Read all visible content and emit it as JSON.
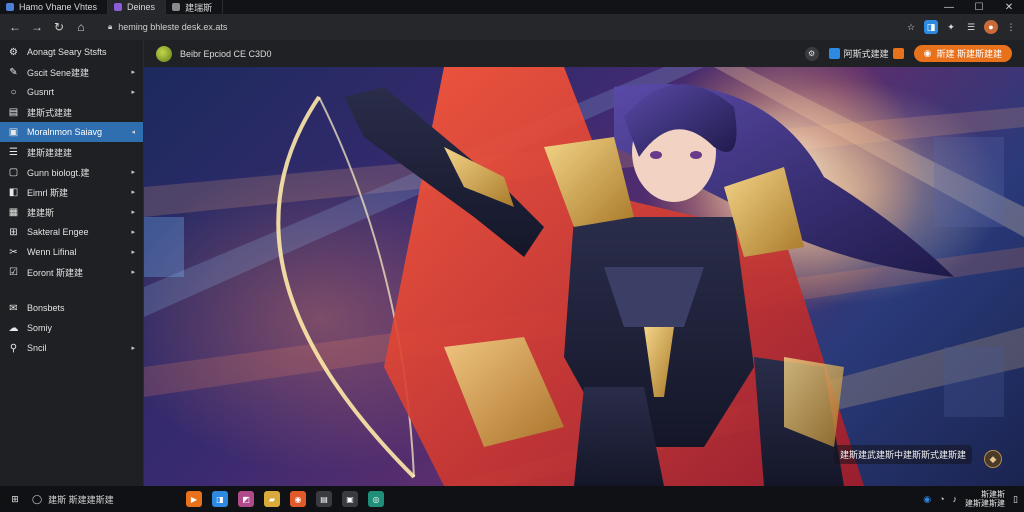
{
  "tabs": [
    {
      "label": "Hamo Vhane Vhtes",
      "color": "#4d7fd6"
    },
    {
      "label": "Deines",
      "color": "#8d5cd8"
    },
    {
      "label": "建瑞斯",
      "color": "#8a8a8a"
    }
  ],
  "window_controls": {
    "minimize": "—",
    "maximize": "☐",
    "close": "✕"
  },
  "address_bar": {
    "url": "heming bhleste desk.ex.ats"
  },
  "sidebar": {
    "items": [
      {
        "label": "Aonagt Seary Stsfts",
        "icon": "gear-icon",
        "glyph": "⚙",
        "arrow": ""
      },
      {
        "label": "Gscit Sene建建",
        "icon": "brush-icon",
        "glyph": "✎",
        "arrow": "▸"
      },
      {
        "label": "Gusnrt",
        "icon": "circle-icon",
        "glyph": "○",
        "arrow": "▸"
      },
      {
        "label": "建斯式建建",
        "icon": "book-icon",
        "glyph": "▤",
        "arrow": ""
      },
      {
        "label": "Moralnmon Saiavg",
        "icon": "window-icon",
        "glyph": "▣",
        "arrow": "◂",
        "active": true
      },
      {
        "label": "建斯建建建",
        "icon": "list-icon",
        "glyph": "☰",
        "arrow": ""
      },
      {
        "label": "Gunn biologt.建",
        "icon": "square-icon",
        "glyph": "▢",
        "arrow": "▸"
      },
      {
        "label": "Eimrl 斯建",
        "icon": "layers-icon",
        "glyph": "◧",
        "arrow": "▸"
      },
      {
        "label": "建建斯",
        "icon": "folder-icon",
        "glyph": "▦",
        "arrow": "▸"
      },
      {
        "label": "Sakteral Engee",
        "icon": "grid-icon",
        "glyph": "⊞",
        "arrow": "▸"
      },
      {
        "label": "Wenn Lifinal",
        "icon": "tool-icon",
        "glyph": "✂",
        "arrow": "▸"
      },
      {
        "label": "Eoront 斯建建",
        "icon": "check-icon",
        "glyph": "☑",
        "arrow": "▸"
      }
    ],
    "bottom_items": [
      {
        "label": "Bonsbets",
        "icon": "mail-icon",
        "glyph": "✉",
        "arrow": ""
      },
      {
        "label": "Somiy",
        "icon": "cloud-icon",
        "glyph": "☁",
        "arrow": ""
      },
      {
        "label": "Sncil",
        "icon": "link-icon",
        "glyph": "⚲",
        "arrow": "▸"
      }
    ]
  },
  "content_header": {
    "title": "Beibr Epciod CE C3D0",
    "chip_label": "阿斯式建建",
    "cta_label": "斯建 斯建斯建建"
  },
  "artwork": {
    "caption": "建斯建武建斯中建斯斯式建斯建",
    "badge_glyph": "◆"
  },
  "taskbar": {
    "search_text": "建斯 斯建建斯建",
    "apps": [
      {
        "name": "files-app-icon",
        "color": "#e8711c",
        "glyph": "▶"
      },
      {
        "name": "store-app-icon",
        "color": "#2d8ae0",
        "glyph": "◨"
      },
      {
        "name": "photos-app-icon",
        "color": "#b04a8a",
        "glyph": "◩"
      },
      {
        "name": "folder-app-icon",
        "color": "#d9a93a",
        "glyph": "▰"
      },
      {
        "name": "browser-app-icon",
        "color": "#e35a2a",
        "glyph": "◉"
      },
      {
        "name": "notes-app-icon",
        "color": "#3a3b40",
        "glyph": "▤"
      },
      {
        "name": "terminal-app-icon",
        "color": "#3a3b40",
        "glyph": "▣"
      },
      {
        "name": "edge-app-icon",
        "color": "#1f8f7a",
        "glyph": "◎"
      }
    ],
    "clock_time": "斯建斯",
    "clock_date": "建斯建斯建"
  },
  "colors": {
    "accent": "#2f6fb0",
    "cta": "#e8711c"
  }
}
